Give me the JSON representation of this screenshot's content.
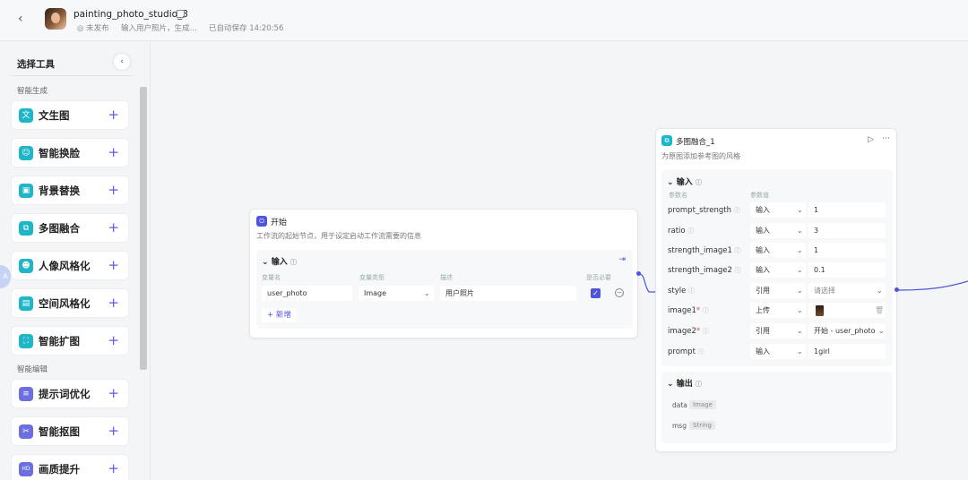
{
  "header": {
    "back_icon": "chevron-left-icon",
    "title": "painting_photo_studio_3",
    "status": "◎ 未发布",
    "description": "输入用户照片，生成…",
    "saved": "已自动保存 14:20:56"
  },
  "sidebar": {
    "title": "选择工具",
    "collapse_icon": "‹",
    "sections": [
      "智能生成",
      "智能编辑"
    ],
    "tools": [
      {
        "label": "文生图",
        "icon": "文",
        "color": "#1fb7c8"
      },
      {
        "label": "智能换脸",
        "icon": "☺",
        "color": "#1fb7c8"
      },
      {
        "label": "背景替换",
        "icon": "▣",
        "color": "#1fb7c8"
      },
      {
        "label": "多图融合",
        "icon": "⧉",
        "color": "#1fb7c8"
      },
      {
        "label": "人像风格化",
        "icon": "☻",
        "color": "#1fb7c8"
      },
      {
        "label": "空间风格化",
        "icon": "▤",
        "color": "#1fb7c8"
      },
      {
        "label": "智能扩图",
        "icon": "⛶",
        "color": "#1fb7c8"
      },
      {
        "label": "提示词优化",
        "icon": "≡",
        "color": "#6b6fe0"
      },
      {
        "label": "智能抠图",
        "icon": "✂",
        "color": "#6b6fe0"
      },
      {
        "label": "画质提升",
        "icon": "HD",
        "color": "#6b6fe0"
      }
    ],
    "add_symbol": "+",
    "float_badge": "A"
  },
  "start_node": {
    "title": "开始",
    "description": "工作流的起始节点，用于设定启动工作流需要的信息",
    "panel_title": "输入",
    "columns": [
      "变量名",
      "变量类型",
      "描述",
      "是否必要"
    ],
    "row": {
      "name": "user_photo",
      "type": "Image",
      "desc": "用户照片"
    },
    "add_label": "新增",
    "add_symbol": "+"
  },
  "fusion_node": {
    "title": "多图融合_1",
    "description": "为原图添加参考图的风格",
    "input_title": "输入",
    "columns": [
      "参数名",
      "参数值"
    ],
    "params": [
      {
        "name": "prompt_strength",
        "mode": "输入",
        "value": "1",
        "required": false
      },
      {
        "name": "ratio",
        "mode": "输入",
        "value": "3",
        "required": false
      },
      {
        "name": "strength_image1",
        "mode": "输入",
        "value": "1",
        "required": false
      },
      {
        "name": "strength_image2",
        "mode": "输入",
        "value": "0.1",
        "required": false
      },
      {
        "name": "style",
        "mode": "引用",
        "value": "请选择",
        "required": false
      },
      {
        "name": "image1",
        "mode": "上传",
        "value": "",
        "required": true
      },
      {
        "name": "image2",
        "mode": "引用",
        "value": "开始 - user_photo",
        "required": true
      },
      {
        "name": "prompt",
        "mode": "输入",
        "value": "1girl",
        "required": false
      }
    ],
    "output_title": "输出",
    "outputs": [
      {
        "name": "data",
        "type": "Image"
      },
      {
        "name": "msg",
        "type": "String"
      }
    ]
  },
  "colors": {
    "accent": "#4f55da",
    "teal": "#1fb7c8"
  }
}
